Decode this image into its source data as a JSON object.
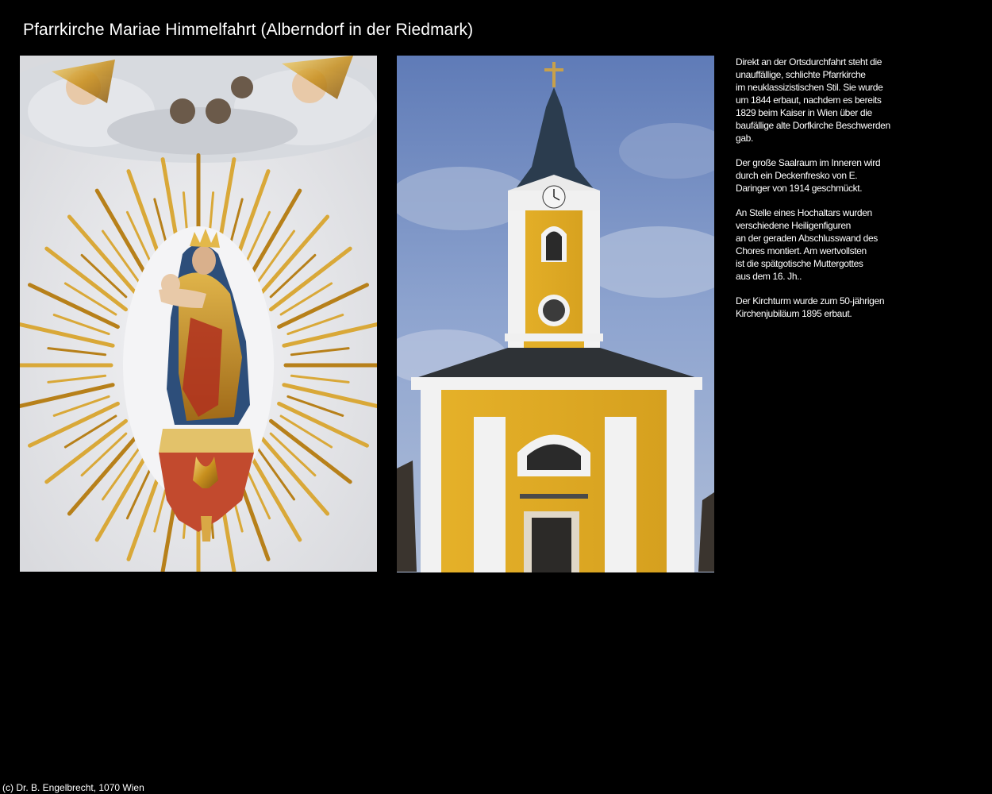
{
  "page": {
    "title": "Pfarrkirche Mariae Himmelfahrt (Alberndorf in der Riedmark)",
    "background_color": "#000000",
    "text_color": "#ffffff"
  },
  "photos": [
    {
      "name": "madonna-altar-photo",
      "subject": "Spätgotische Muttergottes mit Strahlenkranz"
    },
    {
      "name": "church-tower-photo",
      "subject": "Kirchturm der Pfarrkirche"
    }
  ],
  "description": {
    "paragraphs": [
      "Direkt an der Ortsdurchfahrt steht die\nunauffällige, schlichte Pfarrkirche\nim neuklassizistischen Stil. Sie wurde\num 1844 erbaut, nachdem es bereits\n1829 beim Kaiser in Wien über die\nbaufällige alte Dorfkirche Beschwerden\ngab.",
      "Der große Saalraum im Inneren wird\ndurch ein Deckenfresko von E.\nDaringer von 1914 geschmückt.",
      "An Stelle eines Hochaltars wurden\nverschiedene Heiligenfiguren\nan der geraden Abschlusswand des\nChores montiert. Am wertvollsten\nist die spätgotische Muttergottes\naus dem 16. Jh..",
      "Der Kirchturm wurde zum 50-jährigen\nKirchenjubiläum 1895 erbaut."
    ]
  },
  "footer": {
    "copyright": "(c) Dr. B. Engelbrecht, 1070 Wien"
  }
}
